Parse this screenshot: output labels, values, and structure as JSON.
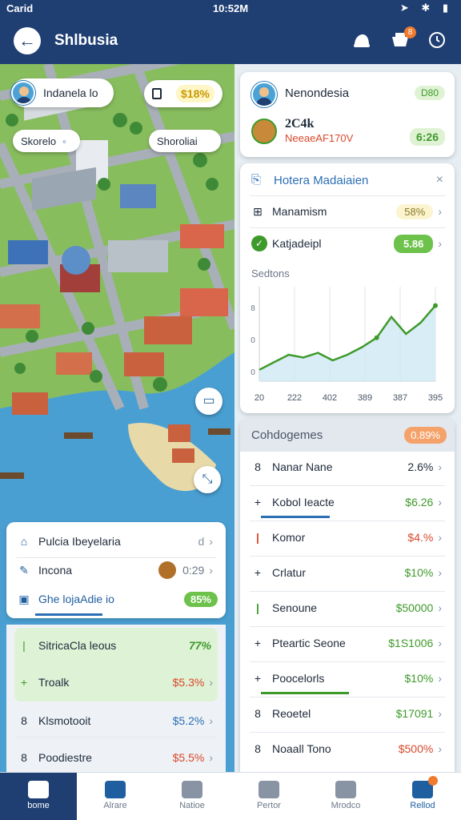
{
  "status_bar": {
    "carrier": "Carid",
    "time": "10:52M"
  },
  "header": {
    "title": "Shlbusia",
    "cart_badge": "8"
  },
  "map": {
    "pill_user": "Indanela lo",
    "pill_price": "$18%",
    "pill_location_left": "Skorelo",
    "pill_location_right": "Shoroliai"
  },
  "left_menu": [
    {
      "label": "Pulcia Ibeyelaria",
      "value": "d",
      "icon": "document-icon"
    },
    {
      "label": "Incona",
      "value": "0:29",
      "icon": "pencil-icon"
    },
    {
      "label": "Ghe lojaAdie io",
      "value": "85%",
      "icon": "tag-icon"
    }
  ],
  "left_list": [
    {
      "label": "SitricaCla leous",
      "value": "77%",
      "color": "green",
      "icon": "bar-icon"
    },
    {
      "label": "Troalk",
      "value": "$5.3%",
      "color": "red",
      "icon": "plus-icon"
    },
    {
      "label": "Klsmotooit",
      "value": "$5.2%",
      "color": "blue",
      "icon": "number-icon"
    },
    {
      "label": "Poodiestre",
      "value": "$5.5%",
      "color": "red",
      "icon": "number-icon"
    }
  ],
  "profile_card": {
    "name": "Nenondesia",
    "name_badge": "D80",
    "code": "2C4k",
    "sub": "NeeaeAF170V",
    "sub_value": "6:26"
  },
  "hotel_card": {
    "title": "Hotera Madaiaien",
    "rows": [
      {
        "label": "Manamism",
        "value": "58%",
        "style": "yellow"
      },
      {
        "label": "Katjadeipl",
        "value": "5.86",
        "style": "green"
      }
    ]
  },
  "chart_data": {
    "type": "line",
    "title": "Sedtons",
    "x": [
      "20",
      "222",
      "402",
      "389",
      "387",
      "395"
    ],
    "y_ticks": [
      "8",
      "0",
      "0"
    ],
    "values": [
      0.12,
      0.2,
      0.28,
      0.25,
      0.3,
      0.22,
      0.28,
      0.36,
      0.46,
      0.68,
      0.5,
      0.62,
      0.8
    ]
  },
  "categories_panel": {
    "title": "Cohdogemes",
    "badge": "0.89%",
    "rows": [
      {
        "label": "Nanar Nane",
        "value": "2.6%",
        "color": "dark",
        "prefix": "8"
      },
      {
        "label": "Kobol Ieacte",
        "value": "$6.26",
        "color": "green",
        "prefix": "+"
      },
      {
        "label": "Komor",
        "value": "$4.%",
        "color": "red",
        "prefix": "|"
      },
      {
        "label": "Crlatur",
        "value": "$10%",
        "color": "green",
        "prefix": "+"
      },
      {
        "label": "Senoune",
        "value": "$50000",
        "color": "green",
        "prefix": "|"
      },
      {
        "label": "Pteartic Seone",
        "value": "$1S1006",
        "color": "green",
        "prefix": "+"
      },
      {
        "label": "Poocelorls",
        "value": "$10%",
        "color": "green",
        "prefix": "+"
      },
      {
        "label": "Reoetel",
        "value": "$17091",
        "color": "green",
        "prefix": "8"
      },
      {
        "label": "Noaall Tono",
        "value": "$500%",
        "color": "red",
        "prefix": "8"
      }
    ]
  },
  "bottom_nav": [
    {
      "label": "bome",
      "icon": "home-icon",
      "active": true
    },
    {
      "label": "Alrare",
      "icon": "map-icon",
      "active": false
    },
    {
      "label": "Natioe",
      "icon": "person-icon",
      "active": false
    },
    {
      "label": "Pertor",
      "icon": "search-icon",
      "active": false
    },
    {
      "label": "Mrodco",
      "icon": "building-icon",
      "active": false
    },
    {
      "label": "Rellod",
      "icon": "chart-icon",
      "active": false
    }
  ]
}
